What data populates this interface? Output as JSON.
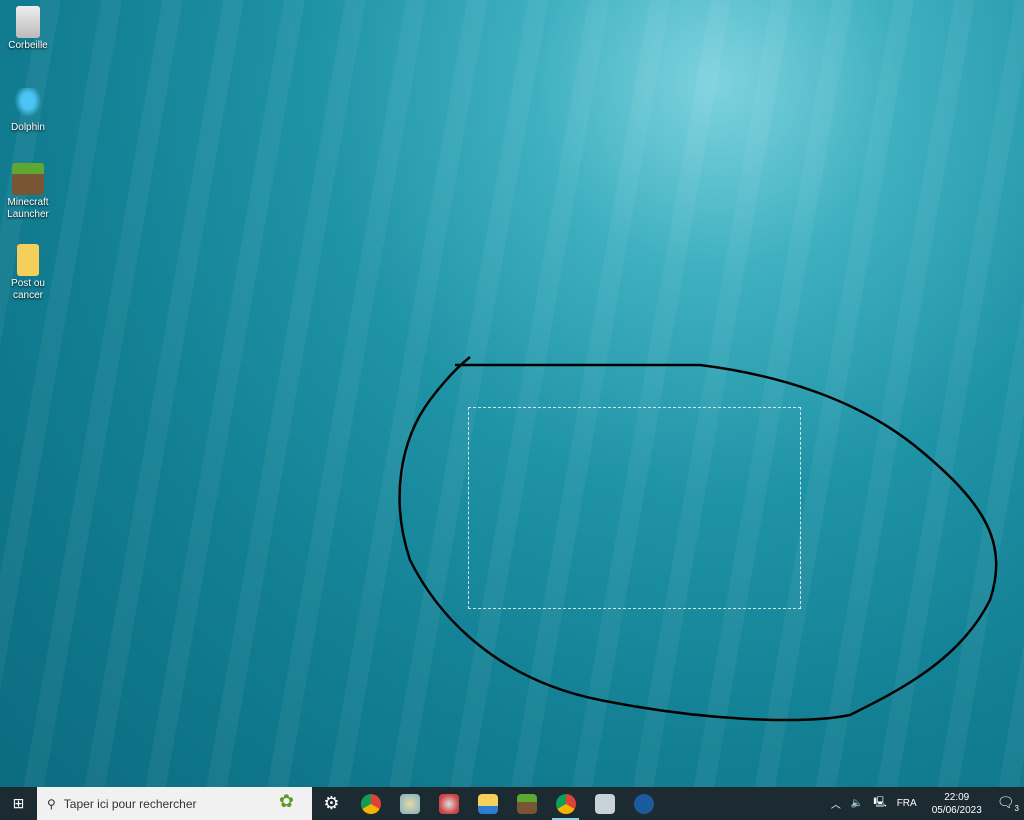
{
  "desktop": {
    "icons": [
      {
        "label": "Corbeille"
      },
      {
        "label": "Dolphin"
      },
      {
        "label": "Minecraft Launcher"
      },
      {
        "label": "Post ou cancer"
      }
    ]
  },
  "taskbar": {
    "search_placeholder": "Taper ici pour rechercher",
    "apps": [
      "settings",
      "chrome",
      "paint",
      "snipping-tool",
      "file-explorer",
      "minecraft",
      "chrome-profile",
      "monitor",
      "steam"
    ],
    "tray": {
      "language": "FRA",
      "time": "22:09",
      "date": "05/06/2023",
      "notifications": "3"
    }
  }
}
